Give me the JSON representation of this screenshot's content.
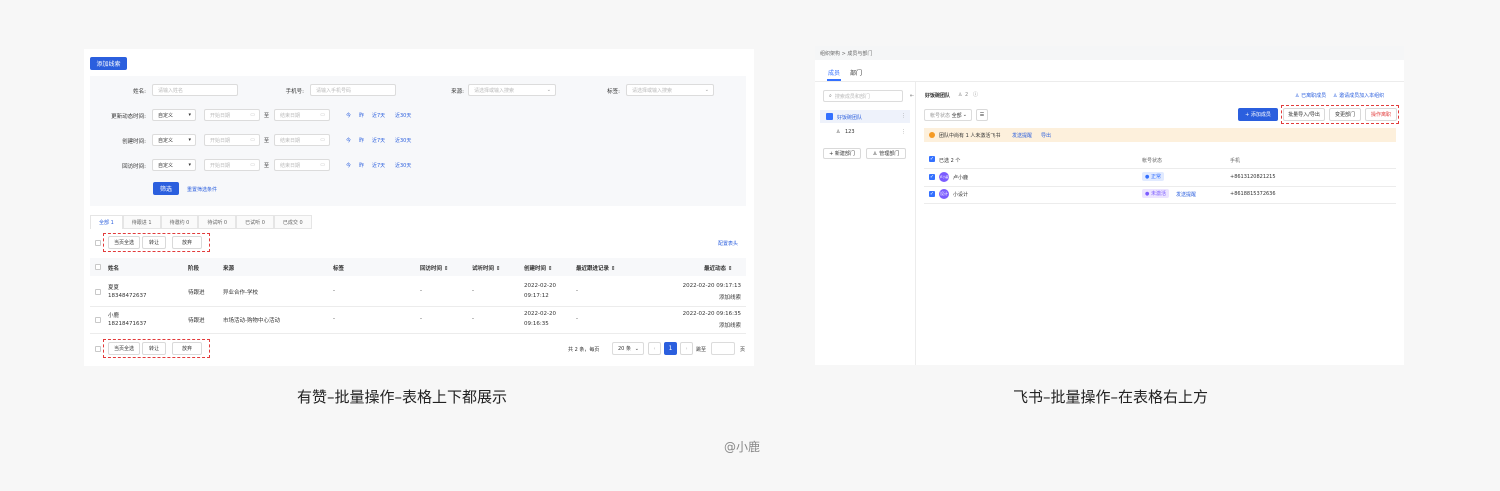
{
  "left": {
    "add_lead": "添加线索",
    "filters": {
      "name_label": "姓名:",
      "name_ph": "请输入姓名",
      "phone_label": "手机号:",
      "phone_ph": "请输入手机号码",
      "source_label": "来源:",
      "source_ph": "请选择或输入搜索",
      "tag_label": "标签:",
      "tag_ph": "请选择或输入搜索",
      "rows": [
        {
          "label": "更新动态时间:",
          "select": "自定义",
          "start": "开始日期",
          "to": "至",
          "end": "结束日期",
          "quick": [
            "今",
            "昨",
            "近7天",
            "近30天"
          ]
        },
        {
          "label": "创建时间:",
          "select": "自定义",
          "start": "开始日期",
          "to": "至",
          "end": "结束日期",
          "quick": [
            "今",
            "昨",
            "近7天",
            "近30天"
          ]
        },
        {
          "label": "回访时间:",
          "select": "自定义",
          "start": "开始日期",
          "to": "至",
          "end": "结束日期",
          "quick": [
            "今",
            "昨",
            "近7天",
            "近30天"
          ]
        }
      ],
      "filter_btn": "筛选",
      "reset": "重置筛选条件"
    },
    "tabs": [
      "全部 1",
      "待跟进 1",
      "待邀约 0",
      "待试听 0",
      "已试听 0",
      "已成交 0"
    ],
    "bulk": {
      "select_all": "当页全选",
      "transfer": "转让",
      "abandon": "放弃"
    },
    "config_header": "配置表头",
    "columns": [
      "姓名",
      "阶段",
      "来源",
      "标签",
      "回访时间 ⇕",
      "试听时间 ⇕",
      "创建时间 ⇕",
      "最近跟进记录 ⇕",
      "最近动态 ⇕"
    ],
    "rows": [
      {
        "name": "夏夏",
        "phone": "18348472637",
        "stage": "待跟进",
        "source": "异业合作-学校",
        "tag": "-",
        "visit": "-",
        "trial": "-",
        "created1": "2022-02-20",
        "created2": "09:17:12",
        "follow": "-",
        "dyn1": "2022-02-20 09:17:13",
        "dyn2": "添加线索"
      },
      {
        "name": "小鹿",
        "phone": "18218471637",
        "stage": "待跟进",
        "source": "市场活动-购物中心活动",
        "tag": "-",
        "visit": "-",
        "trial": "-",
        "created1": "2022-02-20",
        "created2": "09:16:35",
        "follow": "-",
        "dyn1": "2022-02-20 09:16:35",
        "dyn2": "添加线索"
      }
    ],
    "pager": {
      "total": "共 2 条，每页",
      "size": "20 条",
      "page": "1",
      "goto": "跳至",
      "unit": "页"
    }
  },
  "right": {
    "breadcrumb": "组织架构 > 成员与部门",
    "tabs": [
      "成员",
      "部门"
    ],
    "search_ph": "搜索成员和部门",
    "tree": [
      {
        "name": "好饭碗团队"
      },
      {
        "name": "123"
      }
    ],
    "new_dept": "+ 新建部门",
    "manage_dept": "管理部门",
    "team_title": "好饭碗团队",
    "team_count": "2",
    "resigned": "已离职成员",
    "invite": "邀请成员加入本组织",
    "status_label": "帐号状态",
    "status_value": "全部",
    "add_member": "+ 添加成员",
    "import_export": "批量导入/导出",
    "change_dept": "变更部门",
    "remove": "操作离职",
    "notice": "团队中尚有 1 人未激活飞书",
    "notice_remind": "发送提醒",
    "notice_export": "导出",
    "selected": "已选 2 个",
    "col_status": "帐号状态",
    "col_phone": "手机",
    "members": [
      {
        "avatar": "卢小鹿",
        "name": "卢小鹿",
        "status": "正常",
        "phone": "+8613120821215",
        "extra": ""
      },
      {
        "avatar": "设计",
        "name": "小设计",
        "status": "未激活",
        "phone": "+8618815372636",
        "extra": "发送提醒"
      }
    ]
  },
  "captions": {
    "left": "有赞–批量操作–表格上下都展示",
    "right": "飞书–批量操作–在表格右上方",
    "credit": "@小鹿"
  },
  "colors": {
    "primary": "#2b5fde",
    "danger_dash": "#e23b3b",
    "feishu_blue": "#3370ff",
    "notice_bg": "#fdf0dc"
  }
}
